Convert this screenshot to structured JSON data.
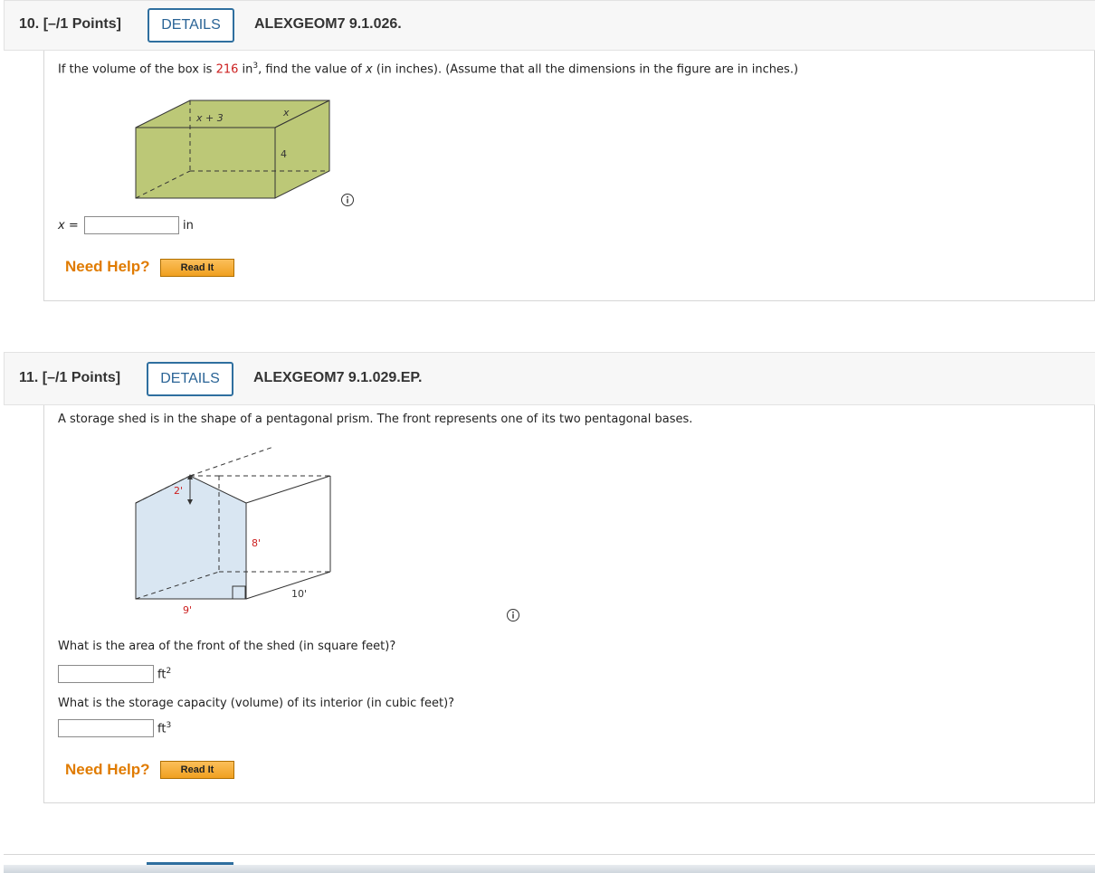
{
  "q10": {
    "number": "10.  [–/1 Points]",
    "details_label": "DETAILS",
    "code": "ALEXGEOM7 9.1.026.",
    "prompt_before": "If the volume of the box is ",
    "volume_value": "216",
    "prompt_unit": " in",
    "prompt_unit_exp": "3",
    "prompt_mid": ", find the value of ",
    "prompt_var": "x",
    "prompt_after": " (in inches). (Assume that all the dimensions in the figure are in inches.)",
    "figure": {
      "label_top": "x + 3",
      "label_right_top": "x",
      "label_side": "4"
    },
    "answer": {
      "label": "x =",
      "value": "",
      "unit": "in"
    },
    "need_help": "Need Help?",
    "read_it": "Read It"
  },
  "q11": {
    "number": "11.  [–/1 Points]",
    "details_label": "DETAILS",
    "code": "ALEXGEOM7 9.1.029.EP.",
    "prompt": "A storage shed is in the shape of a pentagonal prism. The front represents one of its two pentagonal bases.",
    "figure": {
      "label_roof": "2'",
      "label_height": "8'",
      "label_width": "9'",
      "label_depth": "10'"
    },
    "question_area": "What is the area of the front of the shed (in square feet)?",
    "area_answer": {
      "value": "",
      "unit": "ft",
      "unit_exp": "2"
    },
    "question_volume": "What is the storage capacity (volume) of its interior (in cubic feet)?",
    "volume_answer": {
      "value": "",
      "unit": "ft",
      "unit_exp": "3"
    },
    "need_help": "Need Help?",
    "read_it": "Read It"
  },
  "colors": {
    "box_fill": "#bcc877",
    "prism_fill": "#d9e6f2",
    "details_border": "#2f6f9f",
    "need_help": "#e07b00",
    "red_value": "#cc1f1f"
  }
}
